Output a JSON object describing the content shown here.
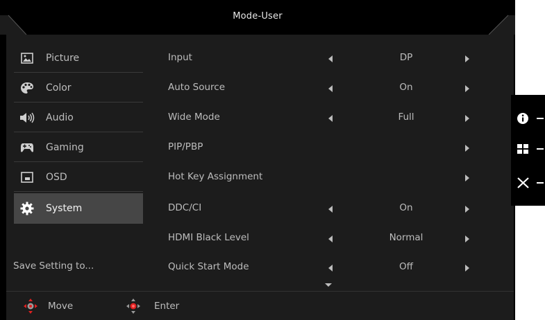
{
  "title": "Mode-User",
  "sidebar": {
    "items": [
      {
        "label": "Picture",
        "icon": "picture-icon"
      },
      {
        "label": "Color",
        "icon": "palette-icon"
      },
      {
        "label": "Audio",
        "icon": "speaker-icon"
      },
      {
        "label": "Gaming",
        "icon": "gamepad-icon"
      },
      {
        "label": "OSD",
        "icon": "osd-icon"
      },
      {
        "label": "System",
        "icon": "gear-icon",
        "active": true
      }
    ],
    "save_label": "Save Setting to..."
  },
  "settings": [
    {
      "label": "Input",
      "value": "DP"
    },
    {
      "label": "Auto Source",
      "value": "On"
    },
    {
      "label": "Wide Mode",
      "value": "Full"
    },
    {
      "label": "PIP/PBP",
      "value": ""
    },
    {
      "label": "Hot Key Assignment",
      "value": ""
    },
    {
      "label": "DDC/CI",
      "value": "On"
    },
    {
      "label": "HDMI Black Level",
      "value": "Normal"
    },
    {
      "label": "Quick Start Mode",
      "value": "Off"
    }
  ],
  "footer": {
    "move_label": "Move",
    "enter_label": "Enter"
  },
  "hotkeys": [
    "info-icon",
    "grid-icon",
    "close-icon"
  ],
  "colors": {
    "background": "#000000",
    "panel": "#1c1c1c",
    "active": "#464646",
    "text": "#bdbdbd",
    "joystick_accent": "#e02020"
  }
}
